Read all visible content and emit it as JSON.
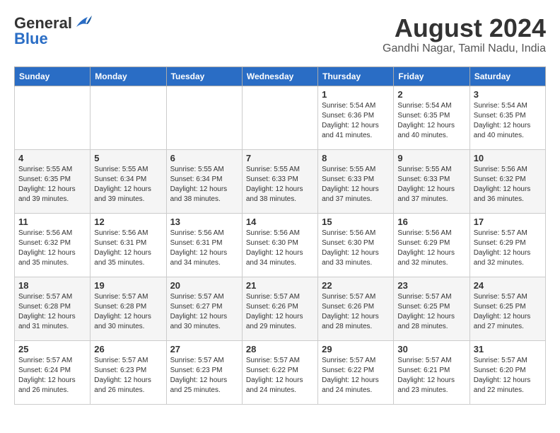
{
  "header": {
    "logo_general": "General",
    "logo_blue": "Blue",
    "month": "August 2024",
    "location": "Gandhi Nagar, Tamil Nadu, India"
  },
  "days_of_week": [
    "Sunday",
    "Monday",
    "Tuesday",
    "Wednesday",
    "Thursday",
    "Friday",
    "Saturday"
  ],
  "weeks": [
    [
      {
        "day": "",
        "info": ""
      },
      {
        "day": "",
        "info": ""
      },
      {
        "day": "",
        "info": ""
      },
      {
        "day": "",
        "info": ""
      },
      {
        "day": "1",
        "info": "Sunrise: 5:54 AM\nSunset: 6:36 PM\nDaylight: 12 hours\nand 41 minutes."
      },
      {
        "day": "2",
        "info": "Sunrise: 5:54 AM\nSunset: 6:35 PM\nDaylight: 12 hours\nand 40 minutes."
      },
      {
        "day": "3",
        "info": "Sunrise: 5:54 AM\nSunset: 6:35 PM\nDaylight: 12 hours\nand 40 minutes."
      }
    ],
    [
      {
        "day": "4",
        "info": "Sunrise: 5:55 AM\nSunset: 6:35 PM\nDaylight: 12 hours\nand 39 minutes."
      },
      {
        "day": "5",
        "info": "Sunrise: 5:55 AM\nSunset: 6:34 PM\nDaylight: 12 hours\nand 39 minutes."
      },
      {
        "day": "6",
        "info": "Sunrise: 5:55 AM\nSunset: 6:34 PM\nDaylight: 12 hours\nand 38 minutes."
      },
      {
        "day": "7",
        "info": "Sunrise: 5:55 AM\nSunset: 6:33 PM\nDaylight: 12 hours\nand 38 minutes."
      },
      {
        "day": "8",
        "info": "Sunrise: 5:55 AM\nSunset: 6:33 PM\nDaylight: 12 hours\nand 37 minutes."
      },
      {
        "day": "9",
        "info": "Sunrise: 5:55 AM\nSunset: 6:33 PM\nDaylight: 12 hours\nand 37 minutes."
      },
      {
        "day": "10",
        "info": "Sunrise: 5:56 AM\nSunset: 6:32 PM\nDaylight: 12 hours\nand 36 minutes."
      }
    ],
    [
      {
        "day": "11",
        "info": "Sunrise: 5:56 AM\nSunset: 6:32 PM\nDaylight: 12 hours\nand 35 minutes."
      },
      {
        "day": "12",
        "info": "Sunrise: 5:56 AM\nSunset: 6:31 PM\nDaylight: 12 hours\nand 35 minutes."
      },
      {
        "day": "13",
        "info": "Sunrise: 5:56 AM\nSunset: 6:31 PM\nDaylight: 12 hours\nand 34 minutes."
      },
      {
        "day": "14",
        "info": "Sunrise: 5:56 AM\nSunset: 6:30 PM\nDaylight: 12 hours\nand 34 minutes."
      },
      {
        "day": "15",
        "info": "Sunrise: 5:56 AM\nSunset: 6:30 PM\nDaylight: 12 hours\nand 33 minutes."
      },
      {
        "day": "16",
        "info": "Sunrise: 5:56 AM\nSunset: 6:29 PM\nDaylight: 12 hours\nand 32 minutes."
      },
      {
        "day": "17",
        "info": "Sunrise: 5:57 AM\nSunset: 6:29 PM\nDaylight: 12 hours\nand 32 minutes."
      }
    ],
    [
      {
        "day": "18",
        "info": "Sunrise: 5:57 AM\nSunset: 6:28 PM\nDaylight: 12 hours\nand 31 minutes."
      },
      {
        "day": "19",
        "info": "Sunrise: 5:57 AM\nSunset: 6:28 PM\nDaylight: 12 hours\nand 30 minutes."
      },
      {
        "day": "20",
        "info": "Sunrise: 5:57 AM\nSunset: 6:27 PM\nDaylight: 12 hours\nand 30 minutes."
      },
      {
        "day": "21",
        "info": "Sunrise: 5:57 AM\nSunset: 6:26 PM\nDaylight: 12 hours\nand 29 minutes."
      },
      {
        "day": "22",
        "info": "Sunrise: 5:57 AM\nSunset: 6:26 PM\nDaylight: 12 hours\nand 28 minutes."
      },
      {
        "day": "23",
        "info": "Sunrise: 5:57 AM\nSunset: 6:25 PM\nDaylight: 12 hours\nand 28 minutes."
      },
      {
        "day": "24",
        "info": "Sunrise: 5:57 AM\nSunset: 6:25 PM\nDaylight: 12 hours\nand 27 minutes."
      }
    ],
    [
      {
        "day": "25",
        "info": "Sunrise: 5:57 AM\nSunset: 6:24 PM\nDaylight: 12 hours\nand 26 minutes."
      },
      {
        "day": "26",
        "info": "Sunrise: 5:57 AM\nSunset: 6:23 PM\nDaylight: 12 hours\nand 26 minutes."
      },
      {
        "day": "27",
        "info": "Sunrise: 5:57 AM\nSunset: 6:23 PM\nDaylight: 12 hours\nand 25 minutes."
      },
      {
        "day": "28",
        "info": "Sunrise: 5:57 AM\nSunset: 6:22 PM\nDaylight: 12 hours\nand 24 minutes."
      },
      {
        "day": "29",
        "info": "Sunrise: 5:57 AM\nSunset: 6:22 PM\nDaylight: 12 hours\nand 24 minutes."
      },
      {
        "day": "30",
        "info": "Sunrise: 5:57 AM\nSunset: 6:21 PM\nDaylight: 12 hours\nand 23 minutes."
      },
      {
        "day": "31",
        "info": "Sunrise: 5:57 AM\nSunset: 6:20 PM\nDaylight: 12 hours\nand 22 minutes."
      }
    ]
  ]
}
